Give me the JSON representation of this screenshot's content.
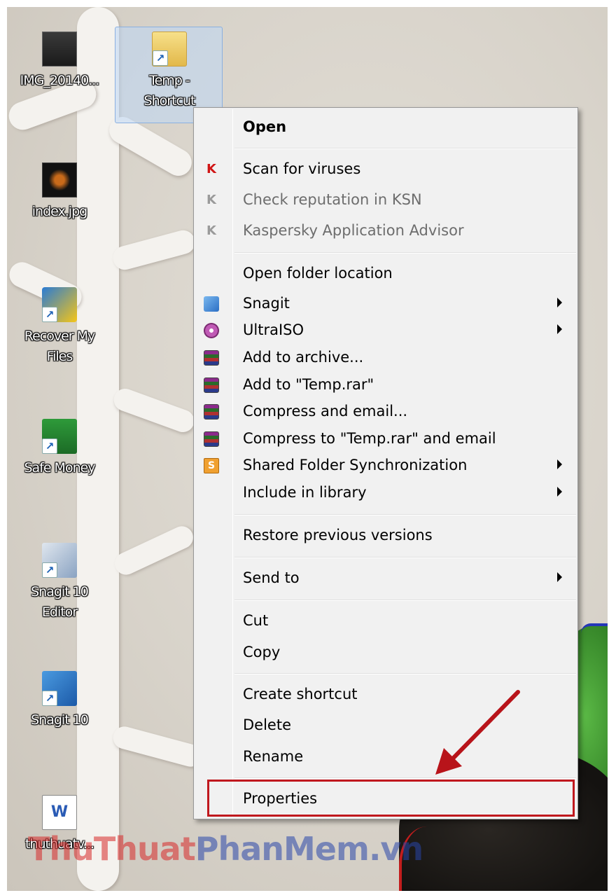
{
  "desktop": {
    "icons": [
      {
        "label": "IMG_20140...",
        "icon": "photo-icon"
      },
      {
        "label": "Temp -\nShortcut",
        "icon": "folder-shortcut-icon"
      },
      {
        "label": "index.jpg",
        "icon": "image-icon"
      },
      {
        "label": "Recover My\nFiles",
        "icon": "recover-app-icon"
      },
      {
        "label": "Safe Money",
        "icon": "safe-money-icon"
      },
      {
        "label": "Snagit 10\nEditor",
        "icon": "snagit-editor-icon"
      },
      {
        "label": "Snagit 10",
        "icon": "snagit-icon"
      },
      {
        "label": "thuthuatv...",
        "icon": "word-document-icon"
      }
    ]
  },
  "menu": {
    "items": [
      {
        "label": "Open",
        "bold": true
      },
      {
        "label": "Scan for viruses",
        "icon": "kaspersky-icon"
      },
      {
        "label": "Check reputation in KSN",
        "icon": "kaspersky-gray-icon",
        "disabled": true
      },
      {
        "label": "Kaspersky Application Advisor",
        "icon": "kaspersky-gray-icon",
        "disabled": true
      },
      {
        "label": "Open folder location"
      },
      {
        "label": "Snagit",
        "icon": "snagit-icon",
        "submenu": true
      },
      {
        "label": "UltraISO",
        "icon": "ultraiso-disc-icon",
        "submenu": true
      },
      {
        "label": "Add to archive...",
        "icon": "winrar-icon"
      },
      {
        "label": "Add to \"Temp.rar\"",
        "icon": "winrar-icon"
      },
      {
        "label": "Compress and email...",
        "icon": "winrar-icon"
      },
      {
        "label": "Compress to \"Temp.rar\" and email",
        "icon": "winrar-icon"
      },
      {
        "label": "Shared Folder Synchronization",
        "icon": "sync-s-icon",
        "submenu": true
      },
      {
        "label": "Include in library",
        "submenu": true
      },
      {
        "label": "Restore previous versions"
      },
      {
        "label": "Send to",
        "submenu": true
      },
      {
        "label": "Cut"
      },
      {
        "label": "Copy"
      },
      {
        "label": "Create shortcut"
      },
      {
        "label": "Delete"
      },
      {
        "label": "Rename"
      },
      {
        "label": "Properties",
        "highlighted": true
      }
    ]
  },
  "annotation": {
    "color": "#c0181e"
  },
  "watermark": {
    "part1": "ThuThuat",
    "part2": "PhanMem.vn"
  }
}
